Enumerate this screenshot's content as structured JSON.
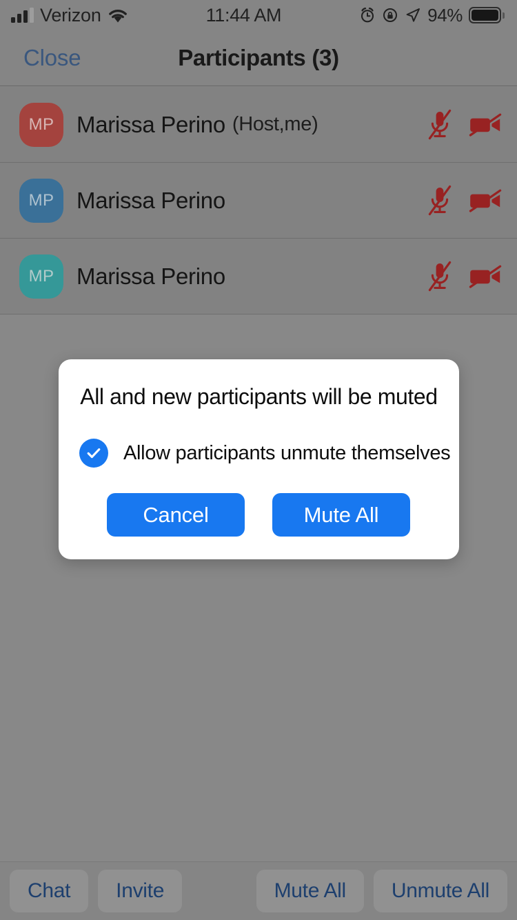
{
  "status_bar": {
    "carrier": "Verizon",
    "time": "11:44 AM",
    "battery_percent": "94%",
    "icons": [
      "signal-bars-icon",
      "wifi-icon",
      "alarm-clock-icon",
      "rotation-lock-icon",
      "location-arrow-icon",
      "battery-icon"
    ]
  },
  "nav_bar": {
    "close_label": "Close",
    "title": "Participants (3)"
  },
  "participants": [
    {
      "initials": "MP",
      "name": "Marissa Perino",
      "role": "(Host,me)",
      "avatar_color": "#b0453f",
      "mic_state": "muted",
      "video_state": "off"
    },
    {
      "initials": "MP",
      "name": "Marissa Perino",
      "role": "",
      "avatar_color": "#3a76a3",
      "mic_state": "muted",
      "video_state": "off"
    },
    {
      "initials": "MP",
      "name": "Marissa Perino",
      "role": "",
      "avatar_color": "#35a3a3",
      "mic_state": "muted",
      "video_state": "off"
    }
  ],
  "alert": {
    "title": "All and new participants will be muted",
    "checkbox_label": "Allow participants unmute themselves",
    "checkbox_checked": true,
    "cancel_label": "Cancel",
    "confirm_label": "Mute All"
  },
  "toolbar": {
    "chat_label": "Chat",
    "invite_label": "Invite",
    "mute_all_label": "Mute All",
    "unmute_all_label": "Unmute All"
  },
  "colors": {
    "accent_blue": "#1878f0",
    "link_blue": "#3a5b86",
    "toolbar_text": "#1d3f6e",
    "muted_icon_red": "#a32020",
    "backdrop": "#8e8e8e"
  }
}
